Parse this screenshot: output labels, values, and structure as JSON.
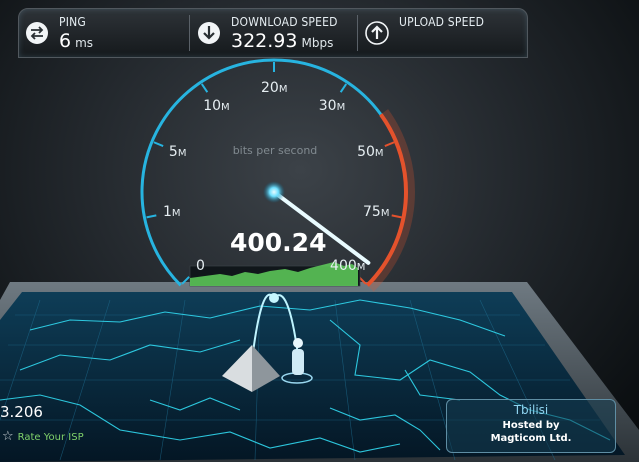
{
  "stats": {
    "ping": {
      "label": "PING",
      "value": "6",
      "unit": "ms",
      "icon": "ping-arrows-icon"
    },
    "download": {
      "label": "DOWNLOAD SPEED",
      "value": "322.93",
      "unit": "Mbps",
      "icon": "download-arrow-icon"
    },
    "upload": {
      "label": "UPLOAD SPEED",
      "icon": "upload-arrow-icon"
    }
  },
  "gauge": {
    "subtitle": "bits per second",
    "current_value": "400.24",
    "needle_fraction": 0.97,
    "ticks": [
      {
        "num": "0",
        "suffix": ""
      },
      {
        "num": "1",
        "suffix": "M"
      },
      {
        "num": "5",
        "suffix": "M"
      },
      {
        "num": "10",
        "suffix": "M"
      },
      {
        "num": "20",
        "suffix": "M"
      },
      {
        "num": "30",
        "suffix": "M"
      },
      {
        "num": "50",
        "suffix": "M"
      },
      {
        "num": "75",
        "suffix": "M"
      },
      {
        "num": "400",
        "suffix": "M"
      }
    ]
  },
  "isp": {
    "value": "3.206",
    "rate_label": "Rate Your ISP"
  },
  "server": {
    "city": "Tbilisi",
    "hosted_line1": "Hosted by",
    "hosted_line2": "Magticom Ltd."
  },
  "colors": {
    "accent_cyan": "#27b4e0",
    "accent_red": "#e5522d",
    "graph_green": "#5fcf5c",
    "panel_bg": "#1d2226"
  }
}
